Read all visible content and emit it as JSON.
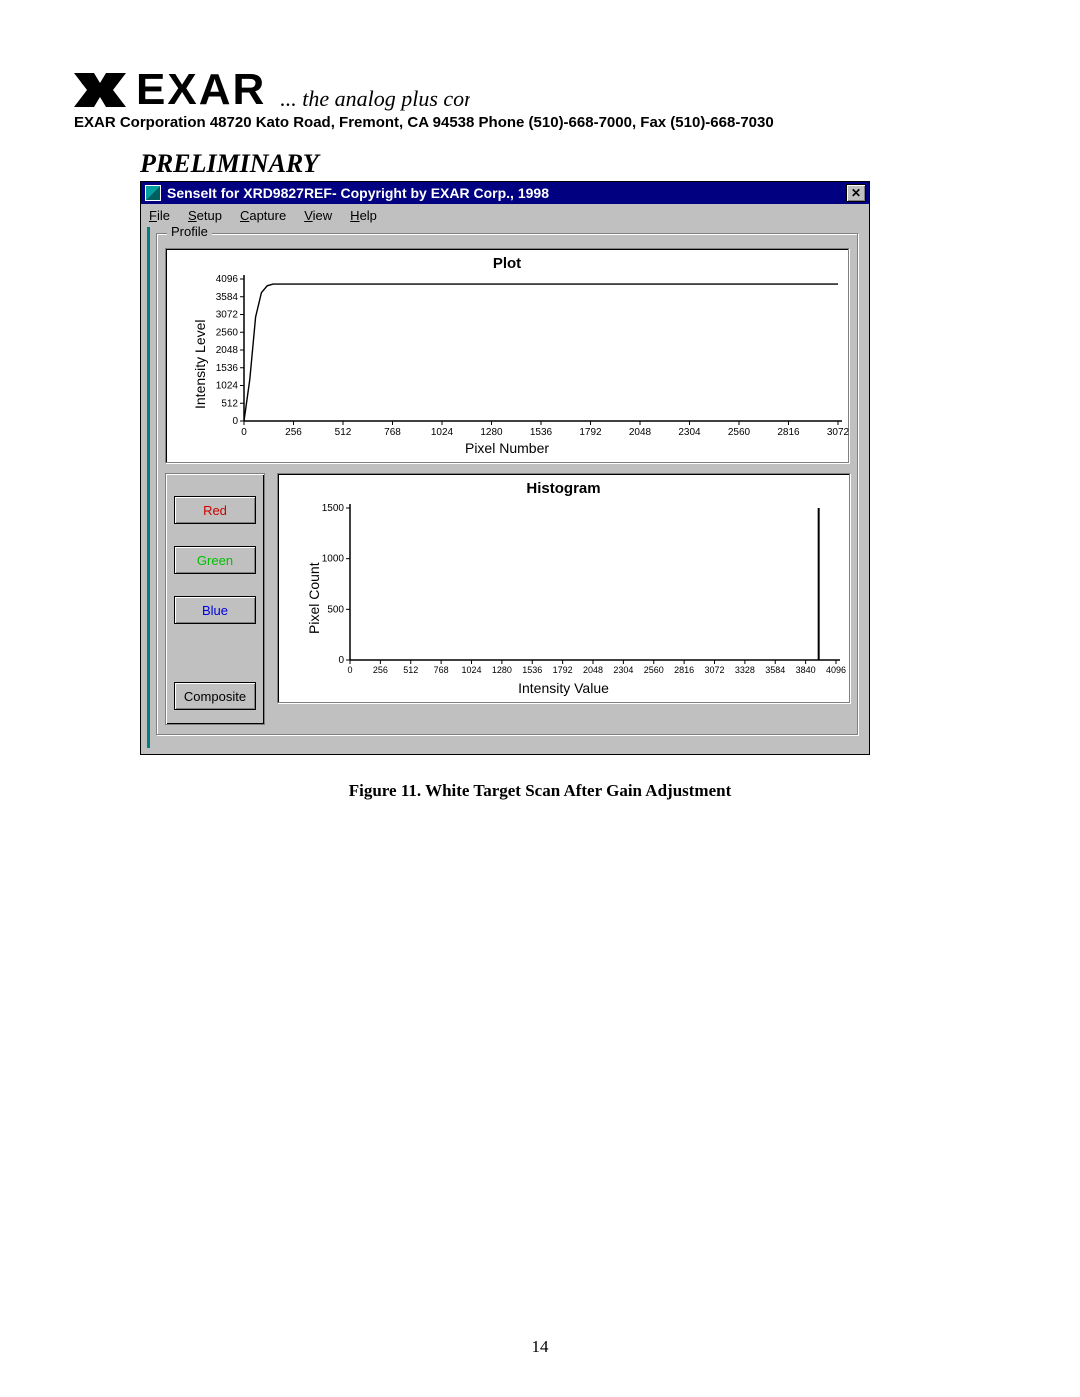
{
  "header": {
    "logo_text": "EXAR",
    "tagline": "... the analog plus compa",
    "address": "EXAR Corporation  48720 Kato Road, Fremont, CA 94538 Phone (510)-668-7000, Fax (510)-668-7030"
  },
  "section_heading": "PRELIMINARY",
  "window": {
    "title": "SenseIt for XRD9827REF- Copyright by EXAR Corp., 1998",
    "menu": {
      "file": "File",
      "setup": "Setup",
      "capture": "Capture",
      "view": "View",
      "help": "Help"
    },
    "group_label": "Profile",
    "buttons": {
      "red": "Red",
      "green": "Green",
      "blue": "Blue",
      "composite": "Composite"
    }
  },
  "caption": "Figure 11. White Target Scan After Gain Adjustment",
  "page_number": "14",
  "chart_data": [
    {
      "type": "line",
      "name": "plot",
      "title": "Plot",
      "xlabel": "Pixel Number",
      "ylabel": "Intensity Level",
      "xlim": [
        0,
        3072
      ],
      "ylim": [
        0,
        4096
      ],
      "x_ticks": [
        0,
        256,
        512,
        768,
        1024,
        1280,
        1536,
        1792,
        2048,
        2304,
        2560,
        2816,
        3072
      ],
      "y_ticks": [
        0,
        512,
        1024,
        1536,
        2048,
        2560,
        3072,
        3584,
        4096
      ],
      "series": [
        {
          "name": "composite",
          "x": [
            0,
            30,
            60,
            90,
            120,
            150,
            3072
          ],
          "values": [
            0,
            1200,
            3000,
            3700,
            3900,
            3950,
            3950
          ]
        }
      ]
    },
    {
      "type": "bar",
      "name": "histogram",
      "title": "Histogram",
      "xlabel": "Intensity Value",
      "ylabel": "Pixel Count",
      "xlim": [
        0,
        4096
      ],
      "ylim": [
        0,
        1500
      ],
      "x_ticks": [
        0,
        256,
        512,
        768,
        1024,
        1280,
        1536,
        1792,
        2048,
        2304,
        2560,
        2816,
        3072,
        3328,
        3584,
        3840,
        4096
      ],
      "y_ticks": [
        0,
        500,
        1000,
        1500
      ],
      "categories": [
        3950
      ],
      "values": [
        1500
      ]
    }
  ]
}
